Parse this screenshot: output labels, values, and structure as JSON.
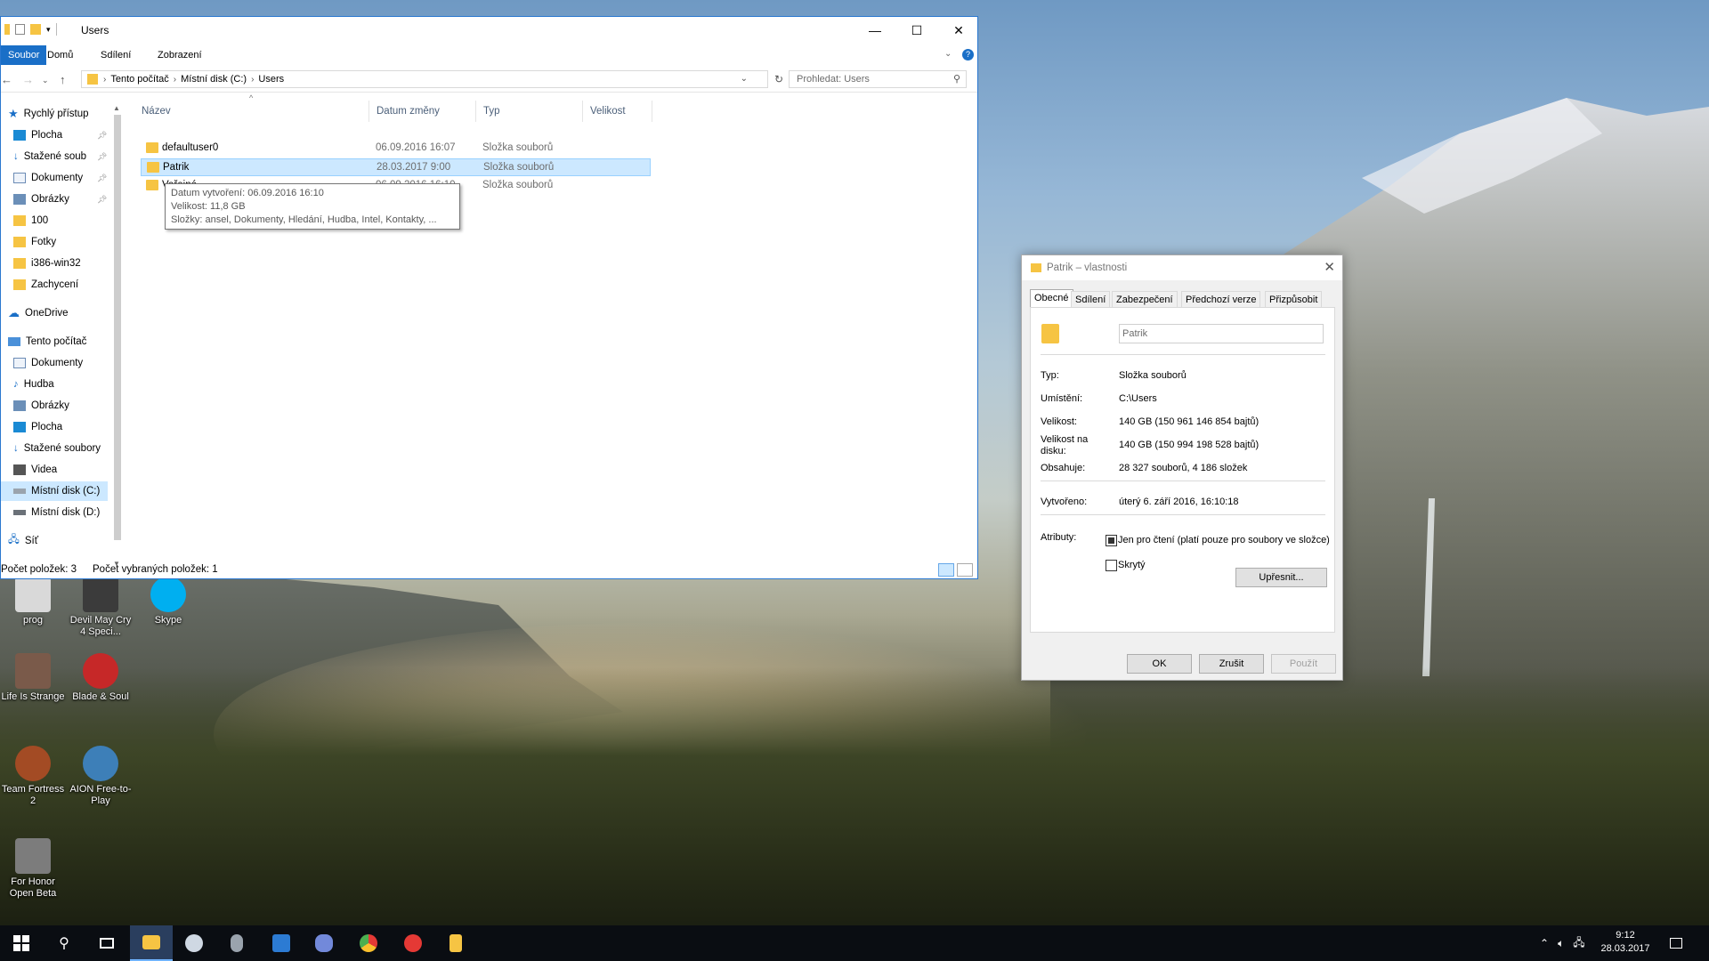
{
  "explorer": {
    "window_title": "Users",
    "ribbon_tabs": [
      "Soubor",
      "Domů",
      "Sdílení",
      "Zobrazení"
    ],
    "breadcrumb": [
      "Tento počítač",
      "Místní disk (C:)",
      "Users"
    ],
    "search_placeholder": "Prohledat: Users",
    "nav": {
      "quick_access": "Rychlý přístup",
      "quick_items": [
        {
          "label": "Plocha",
          "icon": "desktop-icon",
          "pinned": true
        },
        {
          "label": "Stažené soub",
          "icon": "download-icon",
          "pinned": true
        },
        {
          "label": "Dokumenty",
          "icon": "documents-icon",
          "pinned": true
        },
        {
          "label": "Obrázky",
          "icon": "pictures-icon",
          "pinned": true
        },
        {
          "label": "100",
          "icon": "folder-icon",
          "pinned": false
        },
        {
          "label": "Fotky",
          "icon": "folder-icon",
          "pinned": false
        },
        {
          "label": "i386-win32",
          "icon": "folder-icon",
          "pinned": false
        },
        {
          "label": "Zachycení",
          "icon": "folder-icon",
          "pinned": false
        }
      ],
      "onedrive": "OneDrive",
      "this_pc": "Tento počítač",
      "pc_items": [
        {
          "label": "Dokumenty",
          "icon": "documents-icon"
        },
        {
          "label": "Hudba",
          "icon": "music-icon"
        },
        {
          "label": "Obrázky",
          "icon": "pictures-icon"
        },
        {
          "label": "Plocha",
          "icon": "desktop-icon"
        },
        {
          "label": "Stažené soubory",
          "icon": "download-icon"
        },
        {
          "label": "Videa",
          "icon": "video-icon"
        },
        {
          "label": "Místní disk (C:)",
          "icon": "drive-icon"
        },
        {
          "label": "Místní disk (D:)",
          "icon": "drive-icon"
        }
      ],
      "network": "Síť"
    },
    "columns": [
      "Název",
      "Datum změny",
      "Typ",
      "Velikost"
    ],
    "rows": [
      {
        "name": "defaultuser0",
        "date": "06.09.2016 16:07",
        "type": "Složka souborů",
        "size": ""
      },
      {
        "name": "Patrik",
        "date": "28.03.2017 9:00",
        "type": "Složka souborů",
        "size": ""
      },
      {
        "name": "Veřejné",
        "date": "06.09.2016 16:10",
        "type": "Složka souborů",
        "size": ""
      }
    ],
    "tooltip": {
      "line1": "Datum vytvoření: 06.09.2016 16:10",
      "line2": "Velikost: 11,8 GB",
      "line3": "Složky: ansel, Dokumenty, Hledání, Hudba, Intel, Kontakty, ..."
    },
    "status": {
      "count": "Počet položek: 3",
      "selected": "Počet vybraných položek: 1"
    }
  },
  "properties": {
    "title": "Patrik – vlastnosti",
    "tabs": [
      "Obecné",
      "Sdílení",
      "Zabezpečení",
      "Předchozí verze",
      "Přizpůsobit"
    ],
    "name_value": "Patrik",
    "fields": [
      {
        "label": "Typ:",
        "value": "Složka souborů"
      },
      {
        "label": "Umístění:",
        "value": "C:\\Users"
      },
      {
        "label": "Velikost:",
        "value": "140 GB (150 961 146 854 bajtů)"
      },
      {
        "label": "Velikost na disku:",
        "value": "140 GB (150 994 198 528 bajtů)"
      },
      {
        "label": "Obsahuje:",
        "value": "28 327 souborů, 4 186 složek"
      }
    ],
    "created": {
      "label": "Vytvořeno:",
      "value": "úterý 6. září 2016, 16:10:18"
    },
    "attributes_label": "Atributy:",
    "readonly_label": "Jen pro čtení (platí pouze pro soubory ve složce)",
    "readonly_checked": true,
    "hidden_label": "Skrytý",
    "hidden_checked": false,
    "advanced_button": "Upřesnit...",
    "ok_button": "OK",
    "cancel_button": "Zrušit",
    "apply_button": "Použít"
  },
  "desktop_icons": [
    {
      "label": "prog",
      "icon": "document-icon",
      "color": "#d9d9d9"
    },
    {
      "label": "Devil May Cry 4 Speci...",
      "icon": "game-icon",
      "color": "#3b3b3b"
    },
    {
      "label": "Skype",
      "icon": "skype-icon",
      "color": "#00aff0"
    },
    {
      "label": "Life Is Strange",
      "icon": "game-icon",
      "color": "#7a5a4a"
    },
    {
      "label": "Blade & Soul",
      "icon": "game-icon",
      "color": "#c62828"
    },
    {
      "label": "Team Fortress 2",
      "icon": "game-icon",
      "color": "#a34b24"
    },
    {
      "label": "AION Free-to-Play",
      "icon": "game-icon",
      "color": "#3d7fb8"
    },
    {
      "label": "For Honor Open Beta",
      "icon": "game-icon",
      "color": "#7c7c7c"
    }
  ],
  "taskbar": {
    "apps": [
      {
        "name": "start-icon",
        "color": "#ffffff"
      },
      {
        "name": "search-icon",
        "color": "#ffffff"
      },
      {
        "name": "task-view-icon",
        "color": "#ffffff"
      },
      {
        "name": "file-explorer-icon",
        "color": "#f6c443"
      },
      {
        "name": "steam-icon",
        "color": "#cfd8e3"
      },
      {
        "name": "app-icon",
        "color": "#9aa3ad"
      },
      {
        "name": "photoshop-icon",
        "color": "#2c7bd3"
      },
      {
        "name": "discord-icon",
        "color": "#7289da"
      },
      {
        "name": "chrome-icon",
        "color": "#4caf50"
      },
      {
        "name": "game-icon",
        "color": "#e53935"
      },
      {
        "name": "notes-icon",
        "color": "#f6c443"
      }
    ],
    "time": "9:12",
    "date": "28.03.2017"
  }
}
